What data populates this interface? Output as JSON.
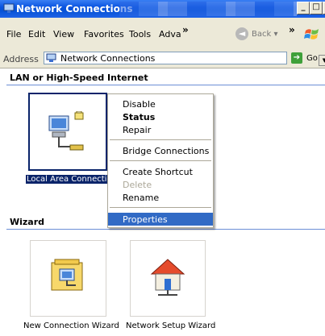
{
  "window": {
    "title": "Network Connections",
    "min": "_",
    "max": "□",
    "close": "×"
  },
  "menu": {
    "items": [
      "File",
      "Edit",
      "View",
      "Favorites",
      "Tools",
      "Adva"
    ],
    "chevron": "»",
    "back": "Back",
    "back_arrow": "◄"
  },
  "address": {
    "label": "Address",
    "value": "Network Connections",
    "dropdown": "▼",
    "go": "Go",
    "go_arrow": "➔"
  },
  "groups": [
    {
      "header": "LAN or High-Speed Internet",
      "items": [
        {
          "label": "Local Area Connection",
          "icon": "network-connection-icon",
          "selected": true
        }
      ]
    },
    {
      "header": "Wizard",
      "items": [
        {
          "label": "New Connection Wizard",
          "icon": "new-connection-wizard-icon"
        },
        {
          "label": "Network Setup Wizard",
          "icon": "network-setup-wizard-icon"
        }
      ]
    }
  ],
  "context_menu": {
    "items": [
      "Disable",
      "Status",
      "Repair",
      "Bridge Connections",
      "Create Shortcut",
      "Delete",
      "Rename",
      "Properties"
    ],
    "bold": "Status",
    "disabled": "Delete",
    "highlighted": "Properties"
  },
  "colors": {
    "accent": "#316ac5",
    "title_blue": "#0a54e0",
    "chrome": "#ece9d8",
    "group_line": "#6c8fd6"
  }
}
